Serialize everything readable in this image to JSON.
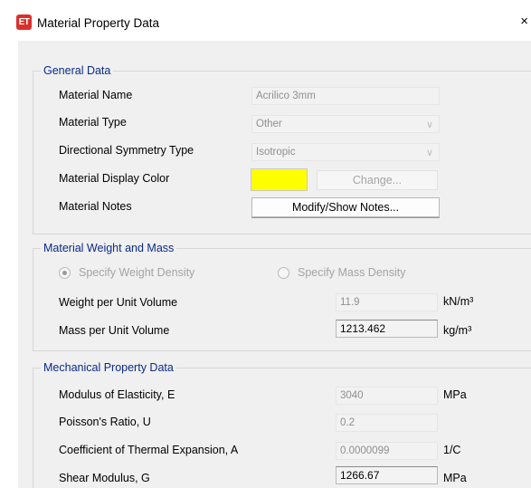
{
  "window": {
    "app_icon_text": "ET",
    "title": "Material Property Data",
    "close_glyph": "×"
  },
  "general": {
    "title": "General Data",
    "name_label": "Material Name",
    "name_value": "Acrilico 3mm",
    "type_label": "Material Type",
    "type_value": "Other",
    "symmetry_label": "Directional Symmetry Type",
    "symmetry_value": "Isotropic",
    "color_label": "Material Display Color",
    "color_value": "#ffff00",
    "change_label": "Change...",
    "notes_label": "Material Notes",
    "notes_button": "Modify/Show Notes..."
  },
  "weight": {
    "title": "Material Weight and Mass",
    "opt_weight": "Specify Weight Density",
    "opt_mass": "Specify Mass Density",
    "selected": "weight",
    "wpuv_label": "Weight per Unit Volume",
    "wpuv_value": "11.9",
    "wpuv_unit": "kN/m³",
    "mpuv_label": "Mass per Unit Volume",
    "mpuv_value": "1213.462",
    "mpuv_unit": "kg/m³"
  },
  "mechanical": {
    "title": "Mechanical Property Data",
    "e_label": "Modulus of Elasticity,  E",
    "e_value": "3040",
    "e_unit": "MPa",
    "u_label": "Poisson's Ratio,  U",
    "u_value": "0.2",
    "a_label": "Coefficient of Thermal Expansion,  A",
    "a_value": "0.0000099",
    "a_unit": "1/C",
    "g_label": "Shear Modulus,  G",
    "g_value": "1266.67",
    "g_unit": "MPa"
  },
  "icons": {
    "app": "etabs-app-icon",
    "close": "close-icon",
    "dropdown": "chevron-down-icon"
  }
}
